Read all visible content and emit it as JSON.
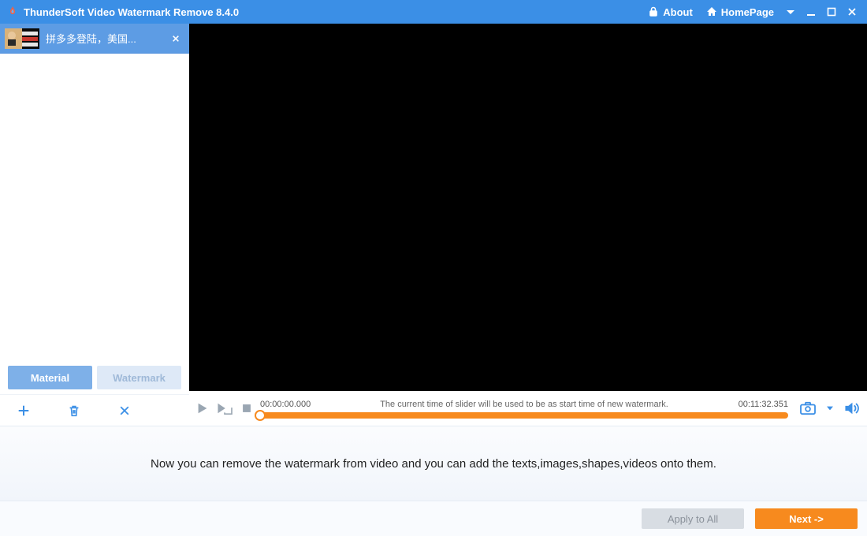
{
  "titlebar": {
    "title": "ThunderSoft Video Watermark Remove 8.4.0",
    "about_label": "About",
    "homepage_label": "HomePage"
  },
  "sidebar": {
    "file_item": {
      "name": "拼多多登陆，美国..."
    },
    "tabs": {
      "material": "Material",
      "watermark": "Watermark"
    }
  },
  "player": {
    "time_start": "00:00:00.000",
    "hint": "The current time of slider will be used to be as start time of new watermark.",
    "time_end": "00:11:32.351"
  },
  "info": {
    "text": "Now you can remove the watermark from video and you can add the texts,images,shapes,videos onto them."
  },
  "buttons": {
    "apply_all": "Apply to All",
    "next": "Next ->"
  },
  "colors": {
    "accent": "#3b8fe6",
    "orange": "#f78a1e"
  }
}
